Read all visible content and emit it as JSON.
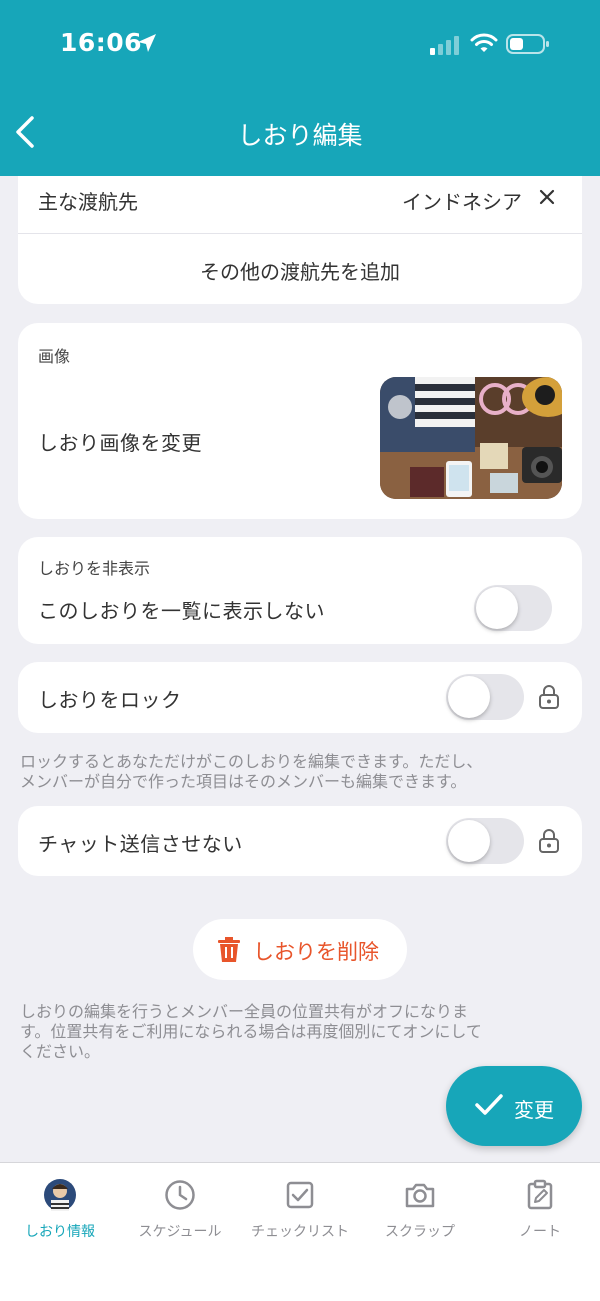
{
  "status_bar": {
    "time": "16:06"
  },
  "header": {
    "title": "しおり編集"
  },
  "destination": {
    "label": "主な渡航先",
    "value": "インドネシア",
    "add_label": "その他の渡航先を追加"
  },
  "image_section": {
    "heading": "画像",
    "change_label": "しおり画像を変更"
  },
  "hide_section": {
    "heading": "しおりを非表示",
    "label": "このしおりを一覧に表示しない",
    "toggle_on": false
  },
  "lock_section": {
    "label": "しおりをロック",
    "toggle_on": false,
    "note_line1": "ロックするとあなただけがこのしおりを編集できます。ただし、",
    "note_line2": "メンバーが自分で作った項目はそのメンバーも編集できます。"
  },
  "chat_section": {
    "label": "チャット送信させない",
    "toggle_on": false
  },
  "delete_button": {
    "label": "しおりを削除"
  },
  "bottom_note": {
    "line1": "しおりの編集を行うとメンバー全員の位置共有がオフになりま",
    "line2": "す。位置共有をご利用になられる場合は再度個別にてオンにして",
    "line3": "ください。"
  },
  "fab": {
    "label": "変更"
  },
  "tabs": [
    {
      "label": "しおり情報",
      "icon": "avatar-icon",
      "active": true
    },
    {
      "label": "スケジュール",
      "icon": "clock-icon",
      "active": false
    },
    {
      "label": "チェックリスト",
      "icon": "checkbox-icon",
      "active": false
    },
    {
      "label": "スクラップ",
      "icon": "camera-icon",
      "active": false
    },
    {
      "label": "ノート",
      "icon": "note-icon",
      "active": false
    }
  ],
  "colors": {
    "accent": "#17a6b9",
    "danger": "#e8552b",
    "background": "#efeff4"
  }
}
